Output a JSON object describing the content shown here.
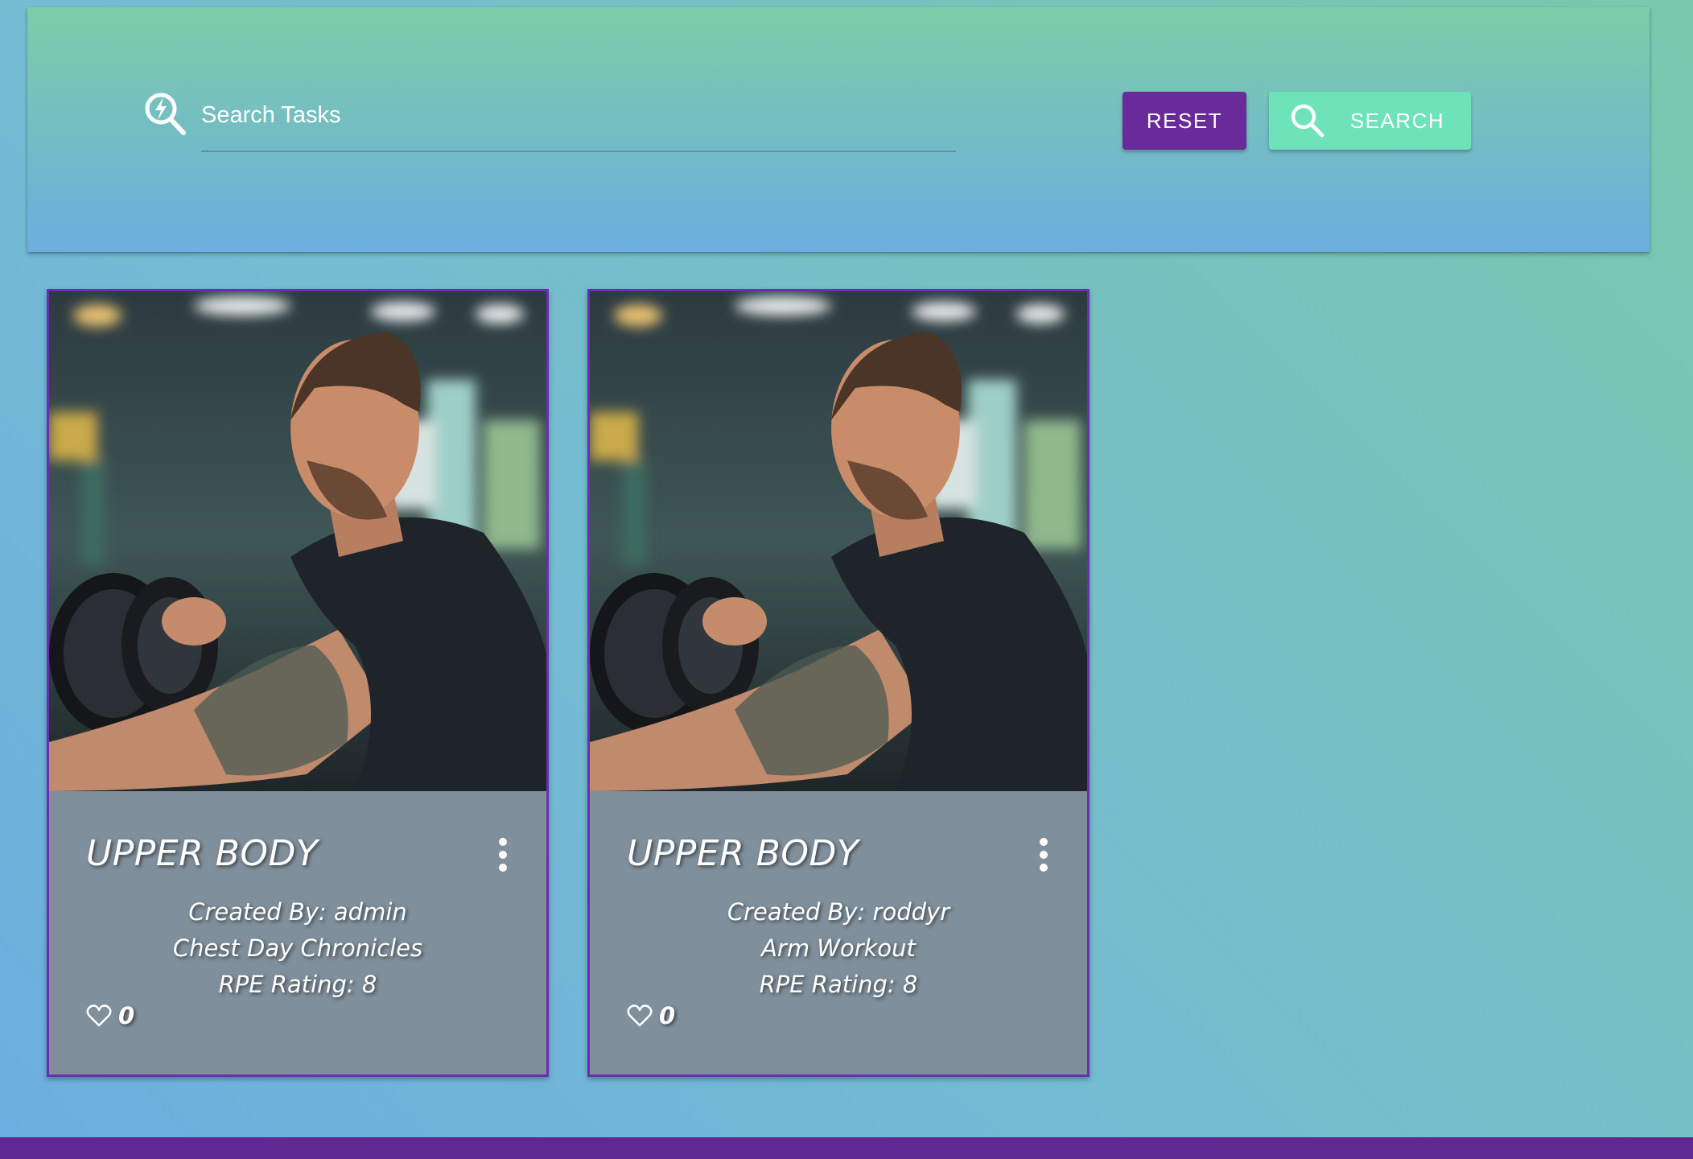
{
  "search": {
    "icon": "search-bolt-icon",
    "placeholder": "Search Tasks",
    "value": ""
  },
  "toolbar": {
    "reset_label": "RESET",
    "search_label": "SEARCH",
    "search_icon": "magnifier-icon"
  },
  "cards": [
    {
      "title": "UPPER BODY",
      "created_by": "Created By: admin",
      "name": "Chest Day Chronicles",
      "rpe": "RPE Rating: 8",
      "likes": "0",
      "image": "man-lifting-dumbbell-photo"
    },
    {
      "title": "UPPER BODY",
      "created_by": "Created By: roddyr",
      "name": "Arm Workout",
      "rpe": "RPE Rating: 8",
      "likes": "0",
      "image": "man-lifting-dumbbell-photo"
    }
  ],
  "colors": {
    "primary": "#6a2b9a",
    "accent": "#6ee2b8",
    "card_body": "#7f8f9b",
    "card_border": "#6a2fb0",
    "footer": "#5e2a91"
  }
}
